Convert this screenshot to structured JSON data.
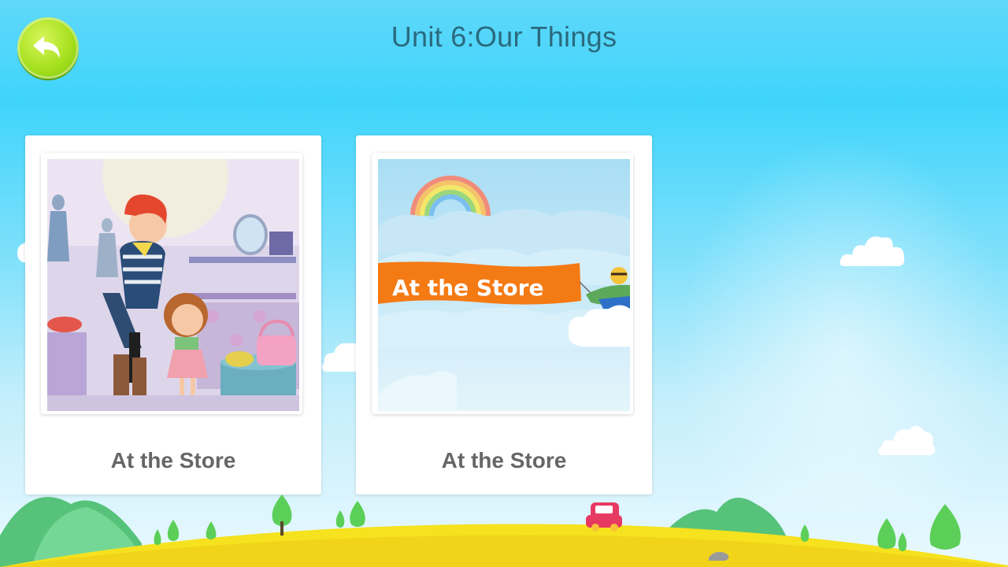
{
  "header": {
    "title": "Unit 6:Our Things",
    "back_icon": "back-arrow-icon"
  },
  "lessons": [
    {
      "label": "At the Store",
      "thumbnail": "store-scene-illustration"
    },
    {
      "label": "At the Store",
      "thumbnail": "rainbow-banner-plane-illustration",
      "banner_text": "At the Store"
    }
  ],
  "colors": {
    "sky": "#3fd4fb",
    "title": "#2a6a7e",
    "back_button": "#a6e01e",
    "card_label": "#666666",
    "banner": "#f47a14",
    "ground": "#f6e21e"
  }
}
